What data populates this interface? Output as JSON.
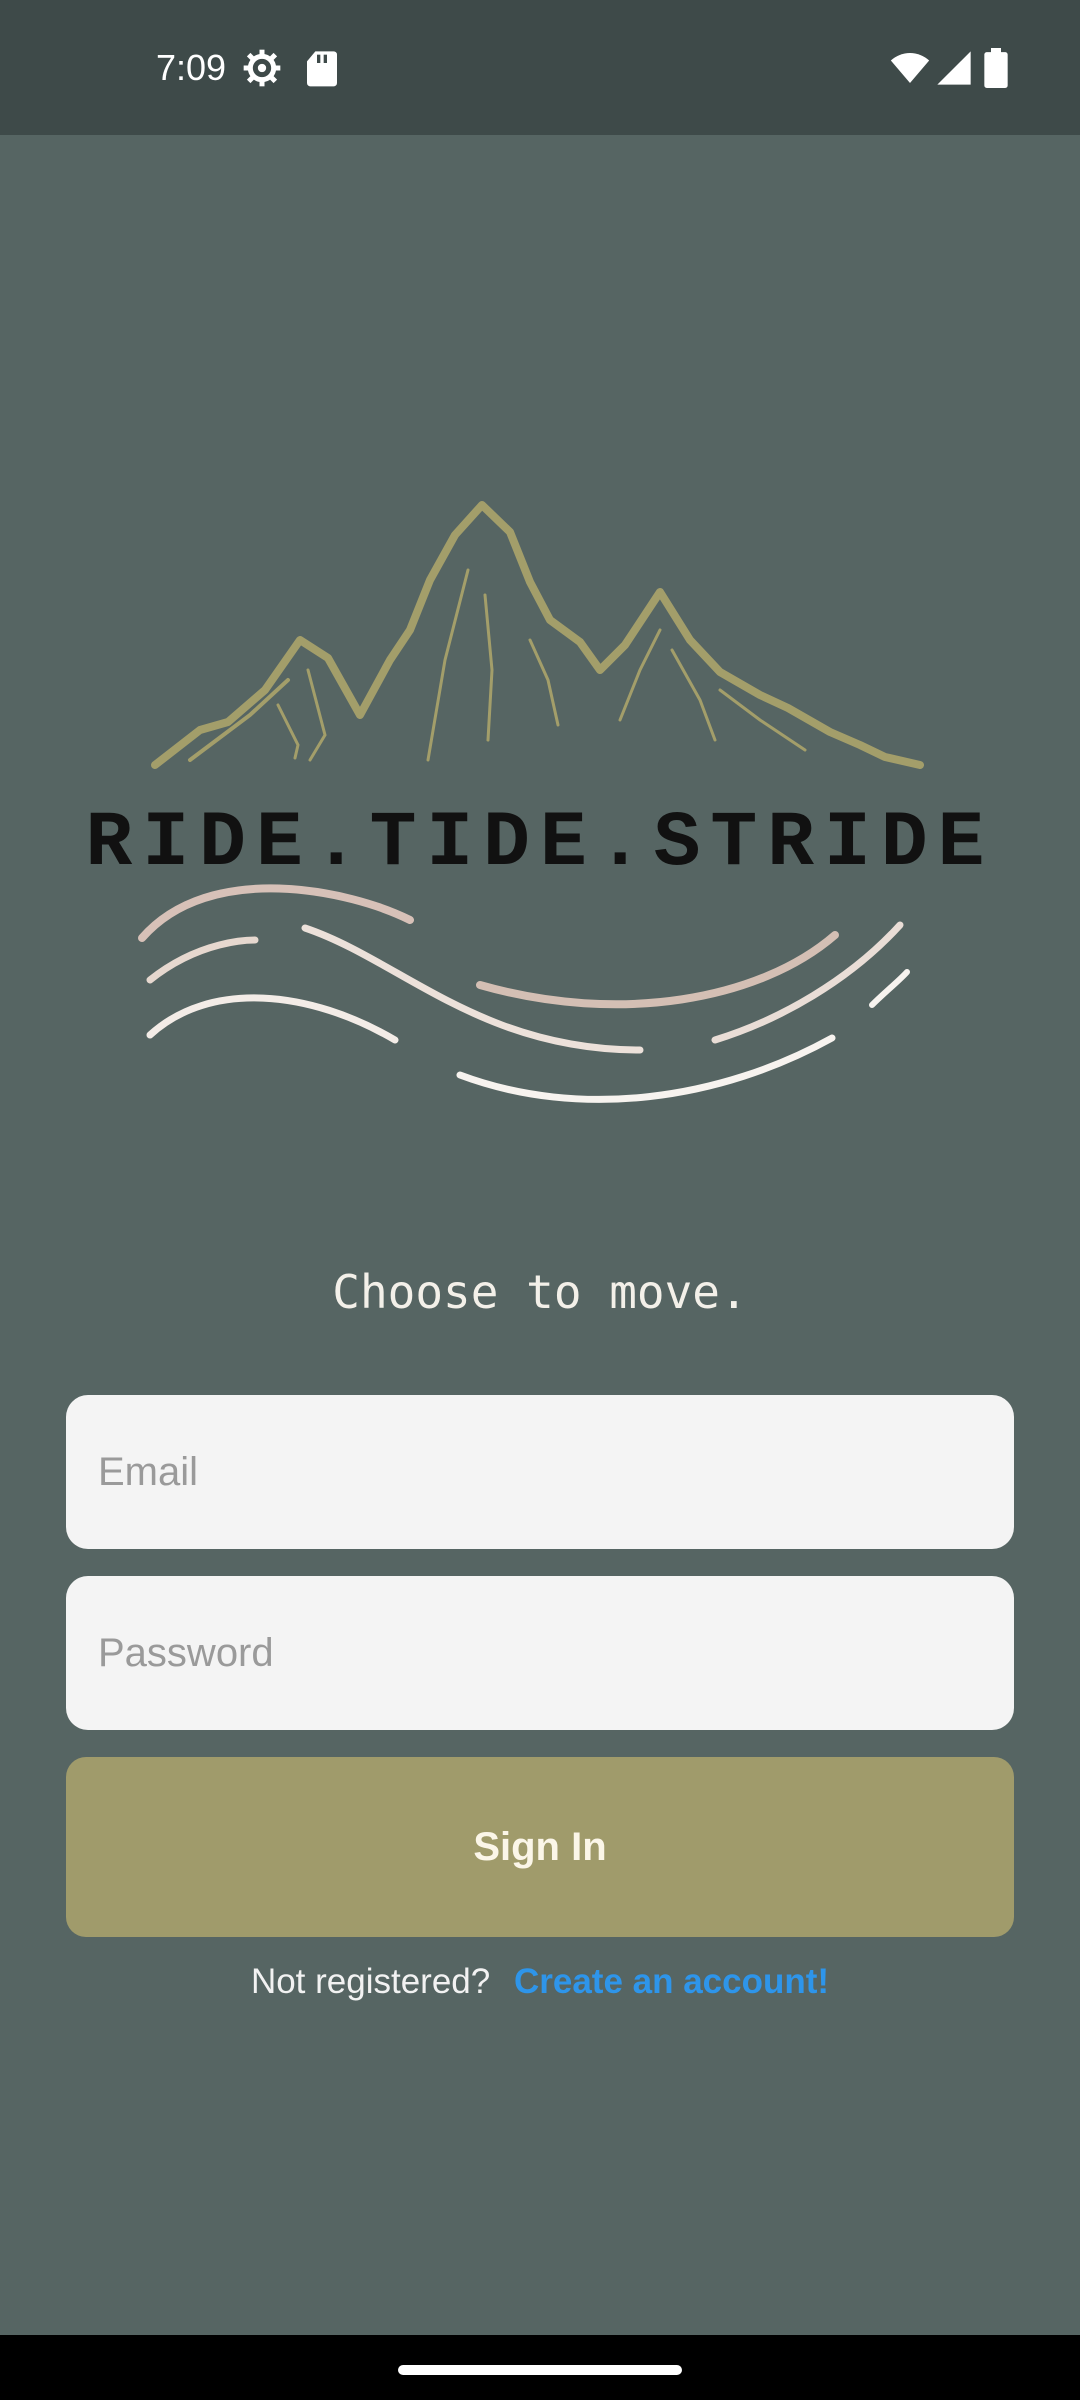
{
  "status_bar": {
    "time": "7:09",
    "icons": [
      "settings-gear-icon",
      "sd-card-icon",
      "wifi-icon",
      "cellular-signal-icon",
      "battery-icon"
    ]
  },
  "logo": {
    "text": "RIDE.TIDE.STRIDE",
    "mountain_color": "#a39e6a",
    "wave_colors": [
      "#d7c1b8",
      "#ece1da",
      "#ffffff"
    ]
  },
  "tagline": "Choose to move.",
  "form": {
    "email_placeholder": "Email",
    "password_placeholder": "Password",
    "signin_label": "Sign In"
  },
  "register": {
    "prompt": "Not registered?",
    "link_label": "Create an account!"
  },
  "colors": {
    "background": "#566563",
    "status_bar": "#3e4a49",
    "button": "#a09b6b",
    "link": "#2e95ea"
  }
}
